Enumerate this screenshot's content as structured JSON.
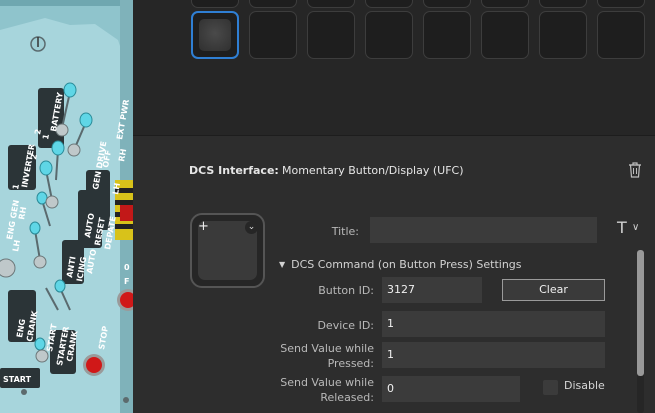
{
  "cockpit": {
    "labels": [
      "BATTERY",
      "1",
      "2",
      "INVERTER",
      "1",
      "2",
      "EXT PWR",
      "GEN DRIVE",
      "OFF",
      "RH",
      "LH",
      "ENG GEN",
      "RH",
      "LH",
      "AUTO",
      "RESET",
      "DEPATE",
      "ANTI",
      "ICING",
      "AUTO",
      "ENG",
      "CRANK",
      "START",
      "STARTER",
      "CRANK",
      "STOP",
      "START",
      "0",
      "F"
    ]
  },
  "key_grid": {
    "slots": 8,
    "selected_index": 0
  },
  "interface": {
    "label": "DCS Interface:",
    "value": "Momentary Button/Display (UFC)"
  },
  "title": {
    "label": "Title:",
    "value": "",
    "t_glyph": "T",
    "caret_glyph": "∨"
  },
  "command_section": {
    "header": "DCS Command (on Button Press) Settings",
    "collapse_glyph": "▼"
  },
  "fields": {
    "button_id_label": "Button ID:",
    "button_id": "3127",
    "clear_label": "Clear",
    "device_id_label": "Device ID:",
    "device_id": "1",
    "pressed_label_1": "Send Value while",
    "pressed_label_2": "Pressed:",
    "pressed_value": "1",
    "released_label_1": "Send Value while",
    "released_label_2": "Released:",
    "released_value": "0",
    "disable_label": "Disable",
    "disable_checked": false
  },
  "preview": {
    "plus_glyph": "+",
    "chevron_glyph": "⌄"
  },
  "colors": {
    "accent": "#2f7fd4",
    "panel_cyan": "#9fd0d8",
    "button_red": "#d01818"
  }
}
